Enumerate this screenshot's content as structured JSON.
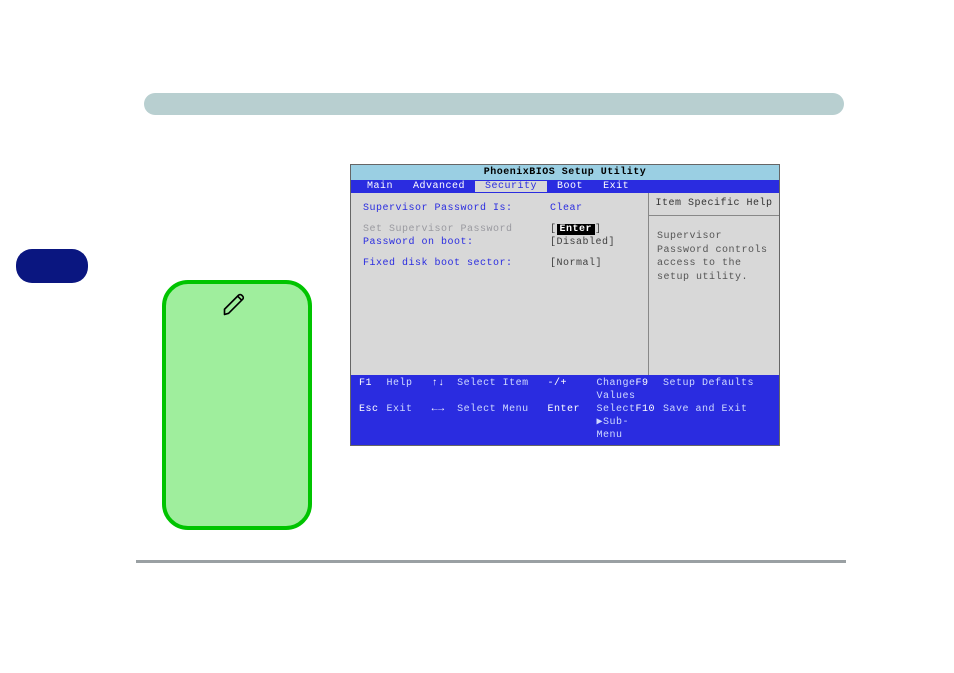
{
  "bios": {
    "title": "PhoenixBIOS Setup Utility",
    "tabs": [
      "Main",
      "Advanced",
      "Security",
      "Boot",
      "Exit"
    ],
    "activeTab": "Security",
    "rows": {
      "supPwdLabel": "Supervisor Password Is:",
      "supPwdVal": "Clear",
      "setSupPwd": "Set Supervisor Password",
      "enter": "Enter",
      "pobLabel": "Password on boot:",
      "pobVal": "[Disabled]",
      "fdbsLabel": "Fixed disk boot sector:",
      "fdbsVal": "[Normal]"
    },
    "help": {
      "title": "Item Specific Help",
      "body": "Supervisor Password controls access to the setup utility."
    },
    "footer": {
      "r1": {
        "k": "F1",
        "l": "Help",
        "a": "↑↓",
        "ac": "Select Item",
        "op": "-/+",
        "ops": "Change Values",
        "fk": "F9",
        "fr": "Setup Defaults"
      },
      "r2": {
        "k": "Esc",
        "l": "Exit",
        "a": "←→",
        "ac": "Select Menu",
        "op": "Enter",
        "ops": "Select ▶Sub-Menu",
        "fk": "F10",
        "fr": "Save and Exit"
      }
    }
  }
}
